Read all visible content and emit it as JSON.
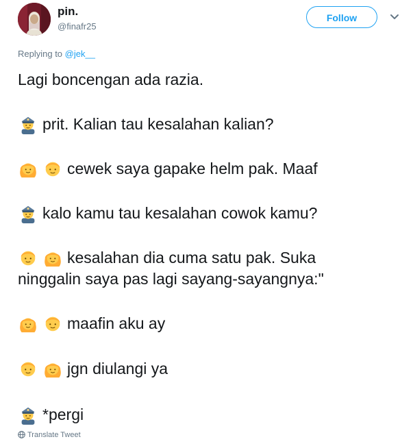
{
  "user": {
    "display_name": "pin.",
    "handle": "@finafr25"
  },
  "follow_button_label": "Follow",
  "reply_context": {
    "prefix": "Replying to ",
    "mention": "@jek__"
  },
  "tweet_lines": [
    {
      "emojis": [],
      "text": "Lagi boncengan ada razia."
    },
    {
      "emojis": [
        "police-officer"
      ],
      "text": "prit. Kalian tau kesalahan kalian?"
    },
    {
      "emojis": [
        "girl",
        "boy"
      ],
      "text": "cewek saya gapake helm pak. Maaf"
    },
    {
      "emojis": [
        "police-officer"
      ],
      "text": "kalo kamu tau kesalahan cowok kamu?"
    },
    {
      "emojis": [
        "boy",
        "girl"
      ],
      "text": "kesalahan dia cuma satu pak. Suka"
    },
    {
      "emojis": [],
      "text": "ninggalin saya pas lagi sayang-sayangnya:\""
    },
    {
      "emojis": [
        "girl",
        "boy"
      ],
      "text": "maafin aku ay"
    },
    {
      "emojis": [
        "boy",
        "girl"
      ],
      "text": "jgn diulangi ya"
    },
    {
      "emojis": [
        "police-officer"
      ],
      "text": "*pergi"
    }
  ],
  "translate_label": "Translate Tweet",
  "colors": {
    "accent": "#1da1f2",
    "text": "#14171a",
    "secondary_text": "#657786"
  }
}
